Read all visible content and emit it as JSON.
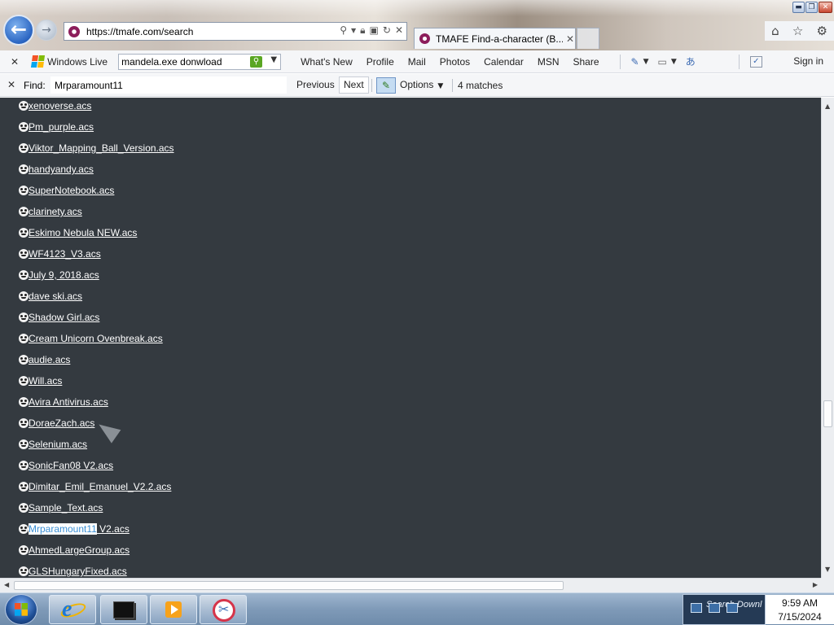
{
  "browser": {
    "address": "https://tmafe.com/search",
    "tab_title": "TMAFE Find-a-character (B...",
    "window_controls": [
      "minimize",
      "restore",
      "close"
    ],
    "nav_icons": [
      "back-arrow-icon",
      "forward-arrow-icon"
    ],
    "address_icons": [
      "search-icon",
      "lock-icon",
      "refresh-icon",
      "close-icon"
    ],
    "right_icons": [
      "home-icon",
      "star-icon",
      "gear-icon"
    ]
  },
  "live_toolbar": {
    "brand": "Windows Live",
    "search_value": "mandela.exe donwload",
    "links": [
      "What's New",
      "Profile",
      "Mail",
      "Photos",
      "Calendar",
      "MSN",
      "Share"
    ],
    "sign_in": "Sign in"
  },
  "find_bar": {
    "label": "Find:",
    "query": "Mrparamount11",
    "previous": "Previous",
    "next": "Next",
    "options": "Options",
    "matches": "4 matches"
  },
  "content": {
    "background": "#343a40",
    "files": [
      {
        "name": "xenoverse.acs"
      },
      {
        "name": "Pm_purple.acs"
      },
      {
        "name": "Viktor_Mapping_Ball_Version.acs"
      },
      {
        "name": "handyandy.acs"
      },
      {
        "name": "SuperNotebook.acs"
      },
      {
        "name": "clarinety.acs"
      },
      {
        "name": "Eskimo Nebula NEW.acs"
      },
      {
        "name": "WF4123_V3.acs"
      },
      {
        "name": "July 9, 2018.acs"
      },
      {
        "name": "dave ski.acs"
      },
      {
        "name": "Shadow Girl.acs"
      },
      {
        "name": "Cream Unicorn Ovenbreak.acs"
      },
      {
        "name": "audie.acs"
      },
      {
        "name": "Will.acs"
      },
      {
        "name": "Avira Antivirus.acs"
      },
      {
        "name": "DoraeZach.acs"
      },
      {
        "name": "Selenium.acs"
      },
      {
        "name": "SonicFan08 V2.acs"
      },
      {
        "name": "Dimitar_Emil_Emanuel_V2.2.acs"
      },
      {
        "name": "Sample_Text.acs"
      },
      {
        "name": "V2.acs",
        "highlight": "Mrparamount11",
        "rest": " V2.acs"
      },
      {
        "name": "AhmedLargeGroup.acs"
      },
      {
        "name": "GLSHungaryFixed.acs"
      }
    ]
  },
  "taskbar": {
    "apps": [
      "Internet Explorer",
      "Command Prompt",
      "Media Player",
      "Snipping Tool"
    ],
    "tray_preview": "Search Downl",
    "time": "9:59 AM",
    "date": "7/15/2024"
  }
}
